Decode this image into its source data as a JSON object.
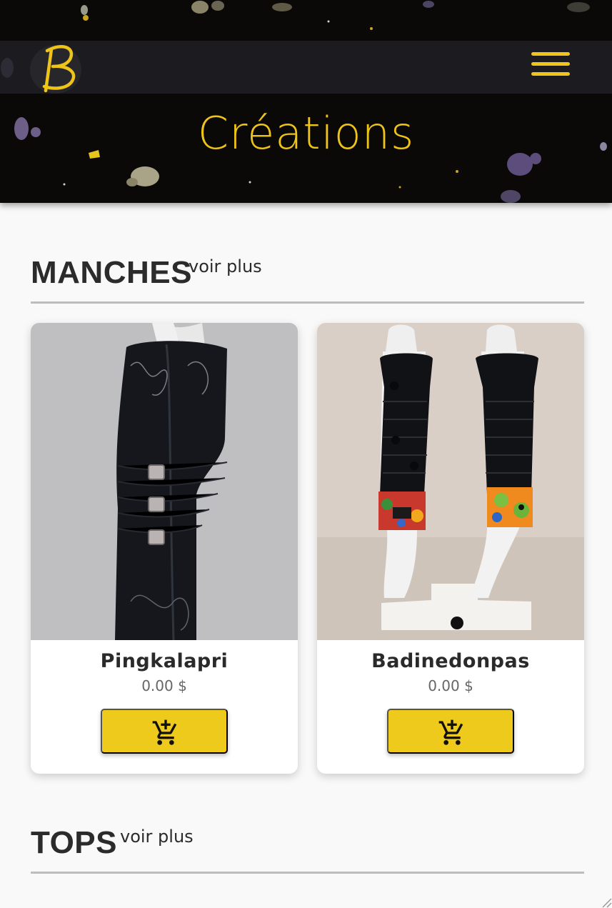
{
  "header": {
    "logo_icon": "b-logo-icon",
    "menu_icon": "hamburger-menu-icon",
    "title": "Créations",
    "accent_color": "#efc418"
  },
  "sections": [
    {
      "title": "MANCHES",
      "see_more_label": "voir plus",
      "products": [
        {
          "name": "Pingkalapri",
          "price": "0.00 $",
          "cart_icon": "add-to-cart-icon"
        },
        {
          "name": "Badinedonpas",
          "price": "0.00 $",
          "cart_icon": "add-to-cart-icon"
        }
      ]
    },
    {
      "title": "TOPS",
      "see_more_label": "voir plus"
    }
  ]
}
